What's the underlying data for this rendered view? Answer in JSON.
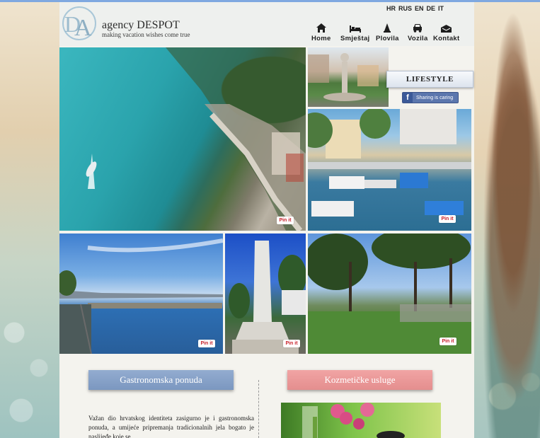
{
  "brand": {
    "name": "agency DESPOT",
    "tagline": "making vacation wishes come true",
    "logo_letters": "DA",
    "logo_small": "agency DESPOT"
  },
  "languages": [
    "HR",
    "RUS",
    "EN",
    "DE",
    "IT"
  ],
  "nav": [
    {
      "label": "Home",
      "icon": "house-icon"
    },
    {
      "label": "Smještaj",
      "icon": "bed-icon"
    },
    {
      "label": "Plovila",
      "icon": "sailboat-icon"
    },
    {
      "label": "Vozila",
      "icon": "car-icon"
    },
    {
      "label": "Kontakt",
      "icon": "envelope-icon"
    }
  ],
  "gallery": {
    "pin_label": "Pin it"
  },
  "sidebar": {
    "lifestyle_label": "LIFESTYLE",
    "fb_share_label": "Sharing is caring"
  },
  "sections": {
    "gastro_button": "Gastronomska ponuda",
    "kozmetika_button": "Kozmetičke usluge",
    "gastro_text": "Važan dio hrvatskog identiteta zasigurno je i gastronomska ponuda, a umijeće pripremanja tradicionalnih jela bogato je naslijeđe koje se"
  },
  "colors": {
    "gastro": "#85a0c8",
    "kozmetika": "#ec9a9a",
    "logo": "#8fb3c9"
  }
}
